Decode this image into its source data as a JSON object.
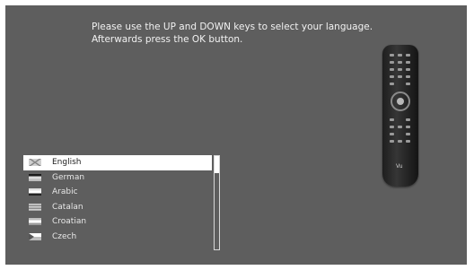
{
  "instructions": {
    "line1": "Please use the UP and DOWN keys to select your language.",
    "line2": "Afterwards press the OK button."
  },
  "languages": [
    {
      "label": "English",
      "flag": "uk-flag-icon",
      "selected": true
    },
    {
      "label": "German",
      "flag": "germany-flag-icon",
      "selected": false
    },
    {
      "label": "Arabic",
      "flag": "arabic-flag-icon",
      "selected": false
    },
    {
      "label": "Catalan",
      "flag": "catalan-flag-icon",
      "selected": false
    },
    {
      "label": "Croatian",
      "flag": "croatia-flag-icon",
      "selected": false
    },
    {
      "label": "Czech",
      "flag": "czech-flag-icon",
      "selected": false
    },
    {
      "label": "",
      "flag": "flag-icon",
      "selected": false
    }
  ],
  "remote": {
    "logo": "Vu"
  },
  "colors": {
    "background": "#5e5e5e",
    "selection": "#ffffff",
    "text": "#e8e8e8"
  }
}
